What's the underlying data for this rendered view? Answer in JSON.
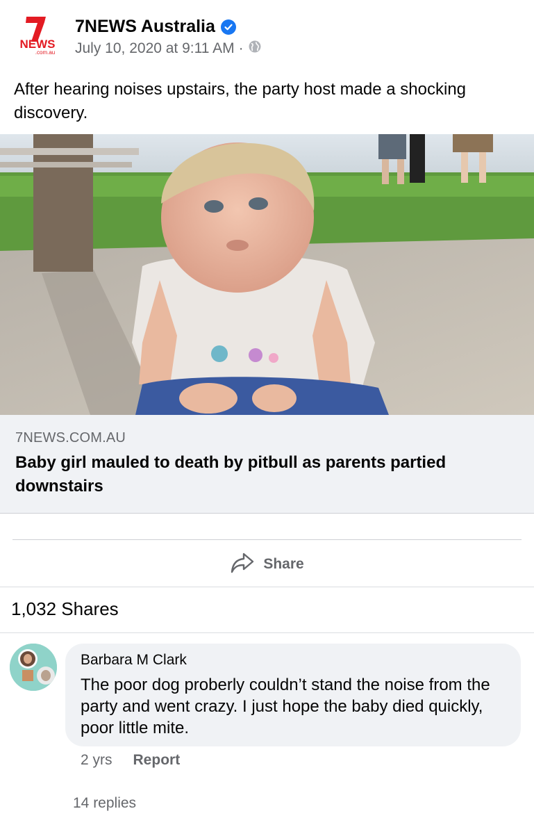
{
  "post": {
    "page_name": "7NEWS Australia",
    "logo_text": "NEWS",
    "logo_sub": ".com.au",
    "timestamp": "July 10, 2020 at 9:11 AM",
    "separator": "·",
    "text": "After hearing noises upstairs, the party host made a shocking discovery."
  },
  "link": {
    "domain": "7NEWS.COM.AU",
    "title": "Baby girl mauled to death by pitbull as parents partied downstairs"
  },
  "actions": {
    "share_label": "Share"
  },
  "stats": {
    "shares": "1,032 Shares"
  },
  "comment": {
    "author": "Barbara M Clark",
    "text": "The poor dog proberly couldn’t stand the noise from the party and went crazy. I just hope the baby died quickly, poor little mite.",
    "time": "2 yrs",
    "report_label": "Report",
    "replies": "14 replies"
  },
  "icons": {
    "verified": "verified-badge-icon",
    "audience": "globe-icon",
    "share": "share-arrow-icon"
  },
  "colors": {
    "brand_red": "#e31b23",
    "verified_blue": "#1877f2",
    "secondary_text": "#65676b",
    "link_bg": "#f0f2f5"
  }
}
